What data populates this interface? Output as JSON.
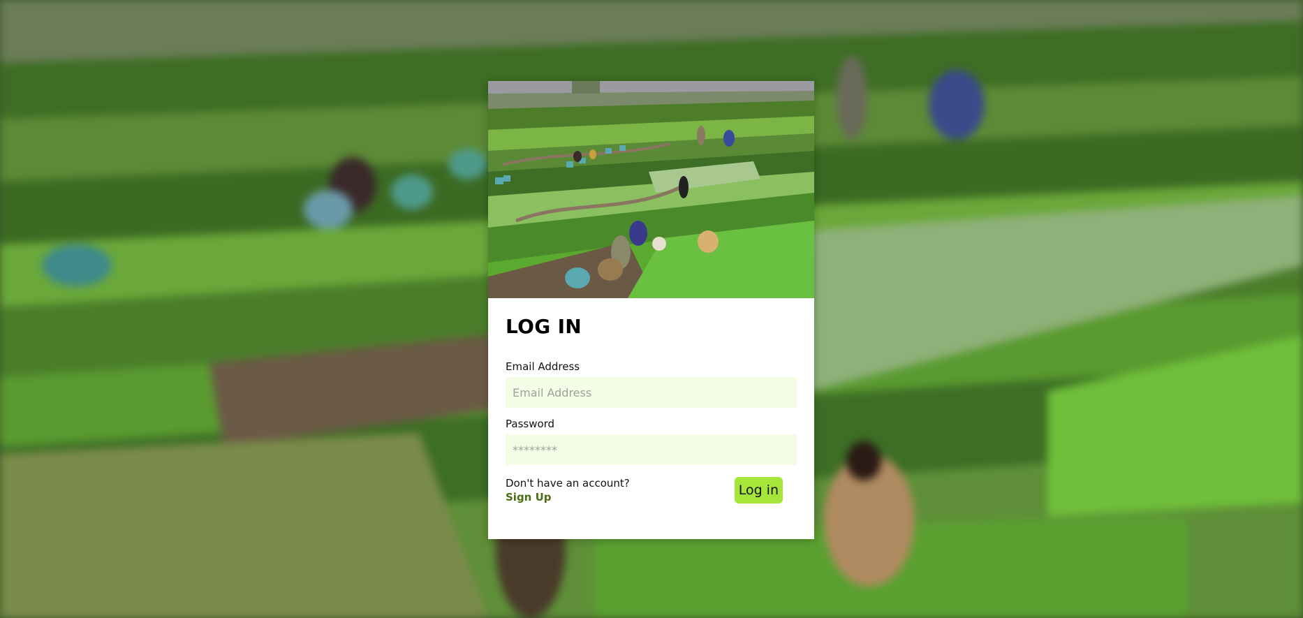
{
  "login": {
    "title": "LOG IN",
    "email_label": "Email Address",
    "email_placeholder": "Email Address",
    "email_value": "",
    "password_label": "Password",
    "password_placeholder": "********",
    "password_value": "",
    "no_account_text": "Don't have an account?",
    "signup_link": "Sign Up",
    "login_button": "Log in"
  },
  "colors": {
    "input_background": "#f3fce4",
    "button_background": "#a6e63a",
    "link_color": "#4c6e12"
  }
}
